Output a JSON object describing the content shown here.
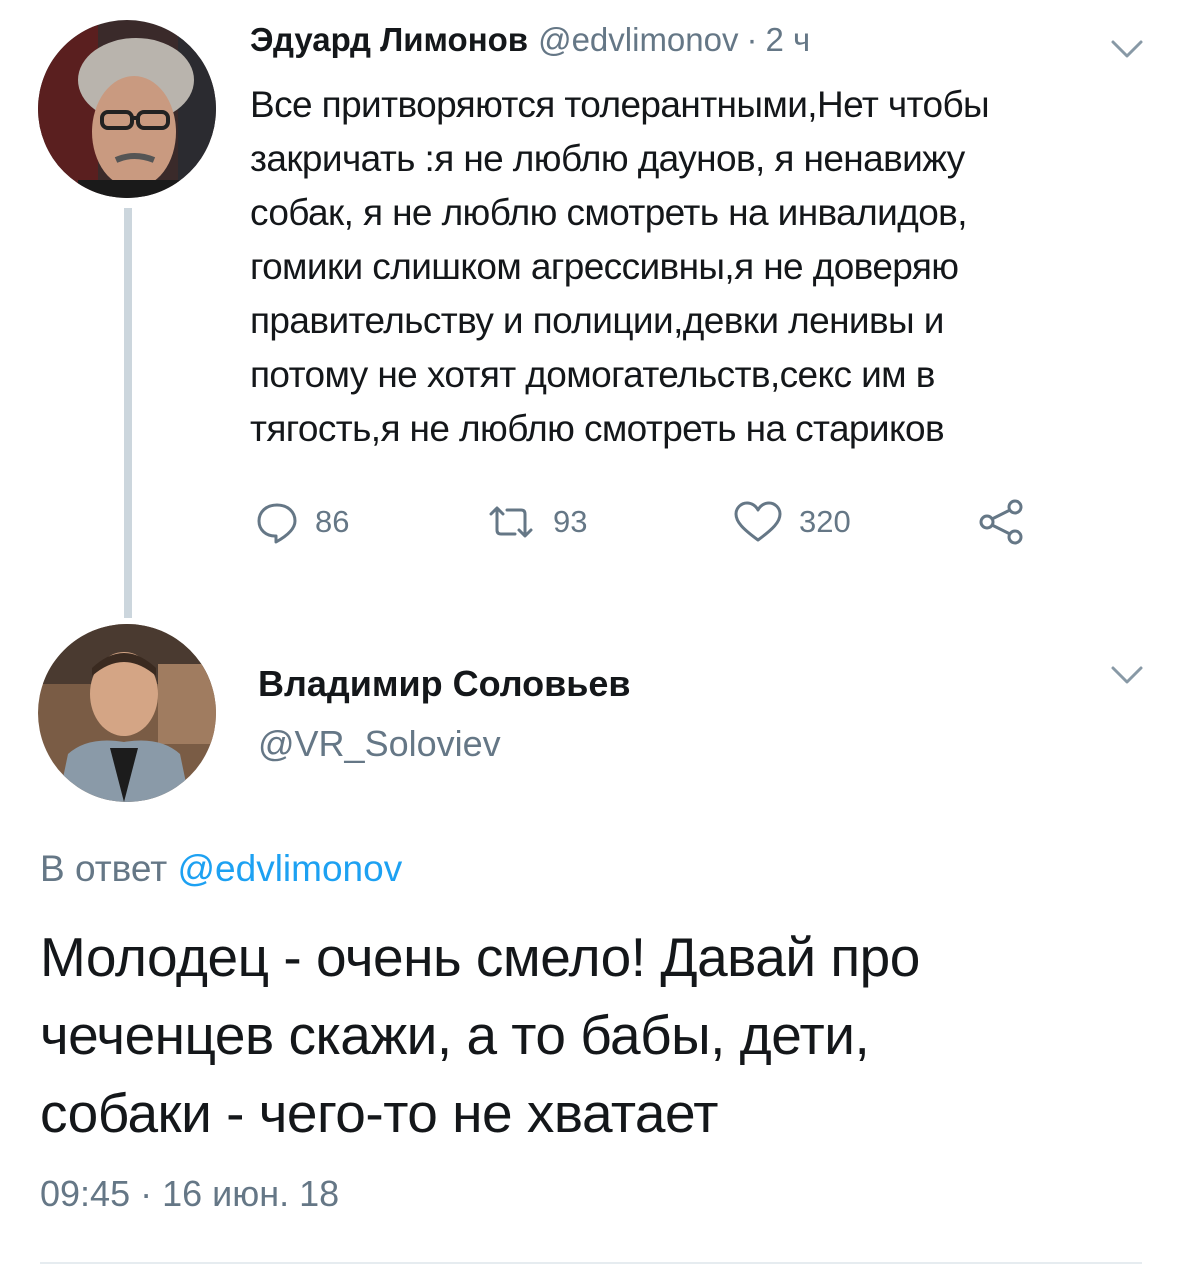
{
  "colors": {
    "text": "#14171a",
    "secondary": "#657786",
    "accent": "#1da1f2",
    "thread_line": "#ccd6dd",
    "divider": "#e6ecf0"
  },
  "parent_tweet": {
    "author_name": "Эдуард Лимонов",
    "author_handle": "@edvlimonov",
    "separator": "·",
    "time_ago": "2 ч",
    "text_lines": [
      "Все притворяются толерантными,Нет чтобы",
      "закричать :я не люблю даунов, я ненавижу",
      "собак, я не люблю смотреть на инвалидов,",
      "гомики слишком агрессивны,я не доверяю",
      "правительству и полиции,девки ленивы и",
      "потому не хотят домогательств,секс им в",
      "тягость,я не люблю смотреть на стариков"
    ],
    "actions": {
      "reply_icon": "reply-icon",
      "reply_count": "86",
      "retweet_icon": "retweet-icon",
      "retweet_count": "93",
      "like_icon": "heart-icon",
      "like_count": "320",
      "share_icon": "share-icon"
    },
    "menu_icon": "chevron-down-icon"
  },
  "reply_tweet": {
    "author_name": "Владимир Соловьев",
    "author_handle": "@VR_Soloviev",
    "reply_prefix": "В ответ",
    "reply_mention": "@edvlimonov",
    "text_lines": [
      "Молодец - очень смело! Давай про",
      "чеченцев скажи, а то бабы, дети,",
      "собаки - чего-то не хватает"
    ],
    "timestamp": "09:45 · 16 июн. 18",
    "menu_icon": "chevron-down-icon"
  }
}
